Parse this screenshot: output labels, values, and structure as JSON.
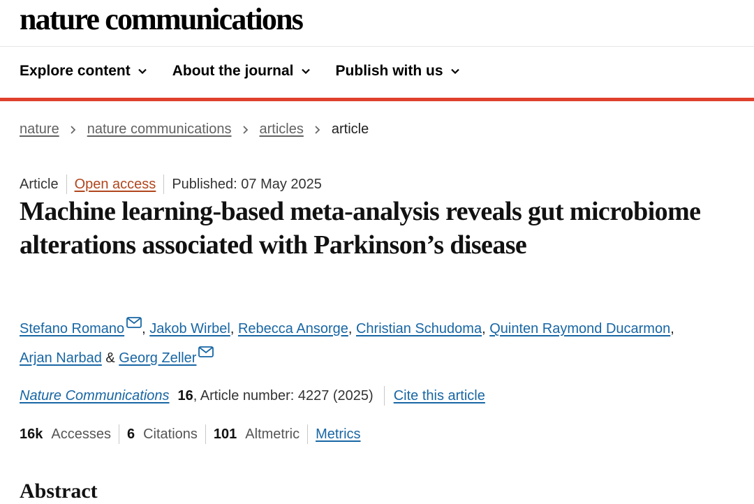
{
  "header": {
    "logo": "nature communications"
  },
  "nav": {
    "items": [
      {
        "label": "Explore content"
      },
      {
        "label": "About the journal"
      },
      {
        "label": "Publish with us"
      }
    ]
  },
  "breadcrumb": [
    "nature",
    "nature communications",
    "articles",
    "article"
  ],
  "article": {
    "type": "Article",
    "access": "Open access",
    "published": "Published: 07 May 2025",
    "title": "Machine learning-based meta-analysis reveals gut microbiome alterations associated with Parkinson’s disease",
    "authors": [
      "Stefano Romano",
      "Jakob Wirbel",
      "Rebecca Ansorge",
      "Christian Schudoma",
      "Quinten Raymond Ducarmon",
      "Arjan Narbad",
      "Georg Zeller"
    ],
    "journal": "Nature Communications",
    "volume": "16",
    "article_number": ", Article number: 4227 (2025)",
    "cite_label": "Cite this article"
  },
  "metrics": {
    "accesses_value": "16k",
    "accesses_label": "Accesses",
    "citations_value": "6",
    "citations_label": "Citations",
    "altmetric_value": "101",
    "altmetric_label": "Altmetric",
    "metrics_link": "Metrics"
  },
  "abstract_heading": "Abstract",
  "colors": {
    "accent_red": "#e0412c",
    "link_blue": "#1866a4",
    "open_access": "#b1461d"
  },
  "icons": {
    "nav": "chevron-down-icon",
    "breadcrumb": "chevron-right-icon",
    "corresponding": "mail-icon"
  }
}
